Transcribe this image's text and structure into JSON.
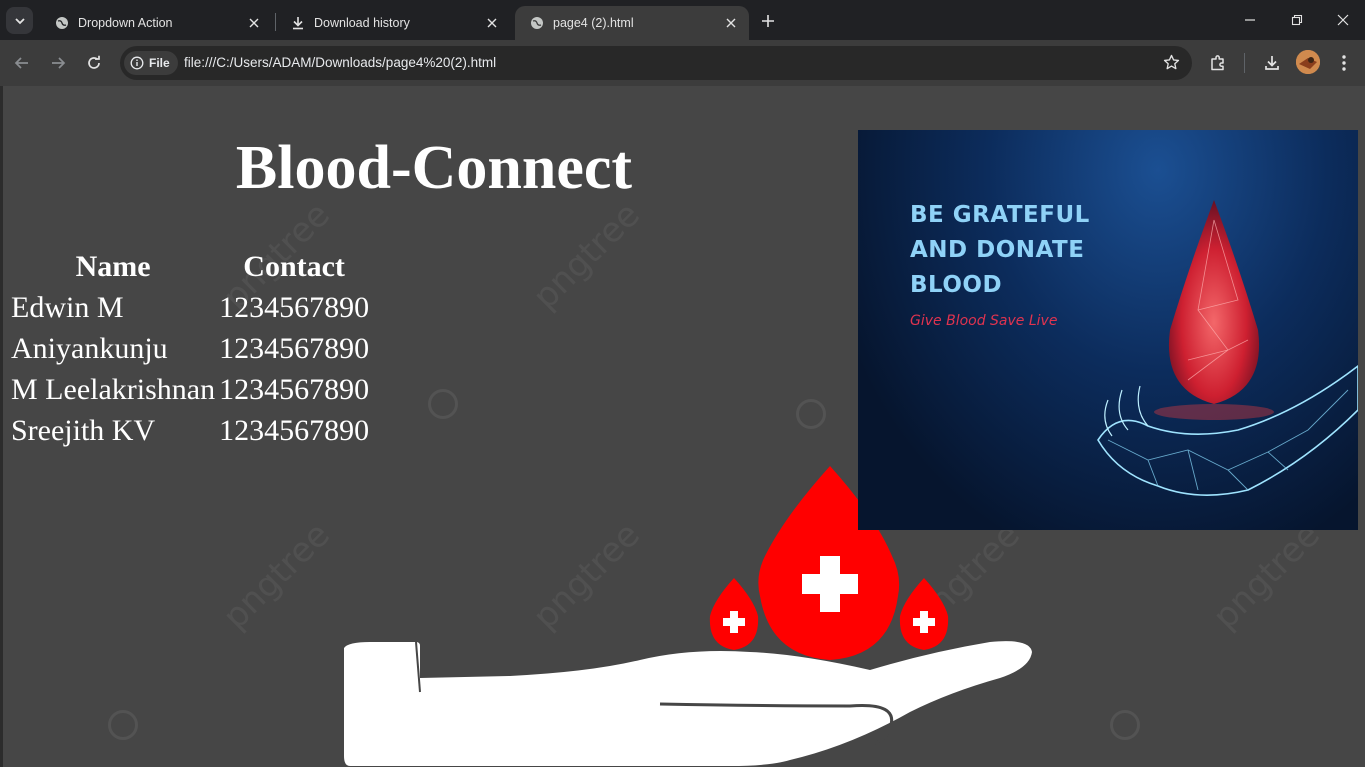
{
  "browser": {
    "tabs": [
      {
        "label": "Dropdown Action",
        "icon": "globe-icon",
        "active": false
      },
      {
        "label": "Download history",
        "icon": "download-icon",
        "active": false
      },
      {
        "label": "page4 (2).html",
        "icon": "globe-icon",
        "active": true
      }
    ],
    "site_chip": "File",
    "url": "file:///C:/Users/ADAM/Downloads/page4%20(2).html"
  },
  "page": {
    "title": "Blood-Connect",
    "table": {
      "headers": [
        "Name",
        "Contact"
      ],
      "rows": [
        [
          "Edwin M",
          "1234567890"
        ],
        [
          "Aniyankunju",
          "1234567890"
        ],
        [
          "M Leelakrishnan",
          "1234567890"
        ],
        [
          "Sreejith KV",
          "1234567890"
        ]
      ]
    },
    "banner": {
      "lines": [
        "BE GRATEFUL",
        "AND DONATE",
        "BLOOD"
      ],
      "tagline": "Give Blood  Save Live"
    },
    "watermark": "pngtree"
  },
  "colors": {
    "page_bg": "#464646",
    "blood_red": "#ff0000",
    "banner_text": "#8fd2f7",
    "tagline": "#e0334f"
  }
}
